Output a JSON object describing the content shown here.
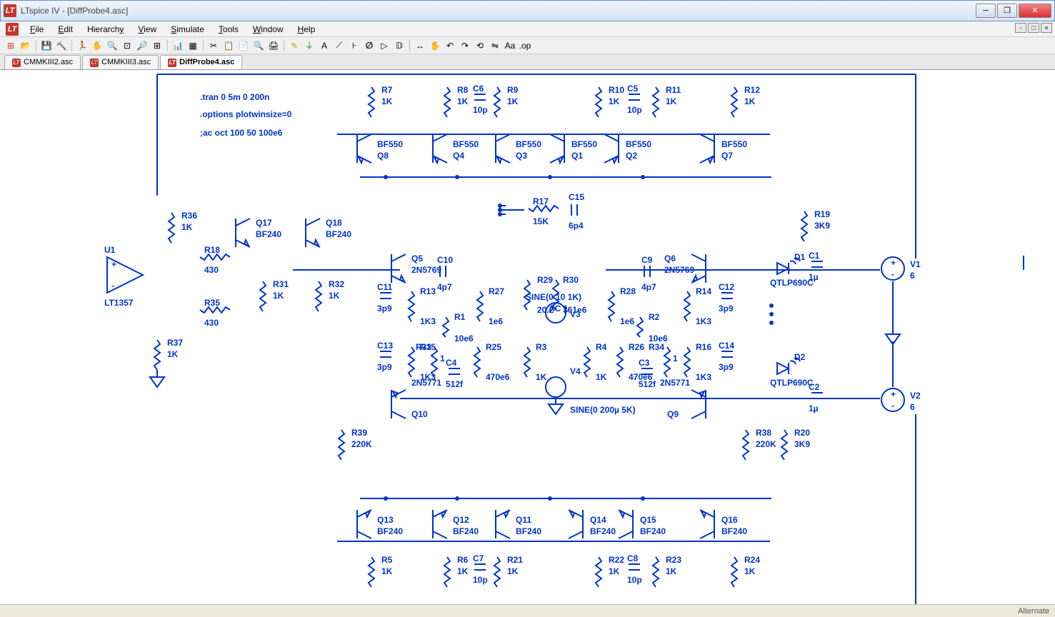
{
  "window": {
    "title": "LTspice IV - [DiffProbe4.asc]"
  },
  "menu": {
    "file": "File",
    "edit": "Edit",
    "hierarchy": "Hierarchy",
    "view": "View",
    "simulate": "Simulate",
    "tools": "Tools",
    "window": "Window",
    "help": "Help"
  },
  "tabs": [
    {
      "label": "CMMKIII2.asc",
      "active": false
    },
    {
      "label": "CMMKIII3.asc",
      "active": false
    },
    {
      "label": "DiffProbe4.asc",
      "active": true
    }
  ],
  "status": {
    "right": "Alternate"
  },
  "directives": [
    ".tran 0 5m 0 200n",
    ".options plotwinsize=0",
    ";ac oct 100 50 100e6"
  ],
  "components": {
    "transistors_top": [
      {
        "ref": "Q8",
        "model": "BF550"
      },
      {
        "ref": "Q4",
        "model": "BF550"
      },
      {
        "ref": "Q3",
        "model": "BF550"
      },
      {
        "ref": "Q1",
        "model": "BF550"
      },
      {
        "ref": "Q2",
        "model": "BF550"
      },
      {
        "ref": "Q7",
        "model": "BF550"
      }
    ],
    "transistors_mid": [
      {
        "ref": "Q17",
        "model": "BF240"
      },
      {
        "ref": "Q18",
        "model": "BF240"
      },
      {
        "ref": "Q5",
        "model": "2N5769"
      },
      {
        "ref": "Q6",
        "model": "2N5769"
      },
      {
        "ref": "Q10",
        "model": "2N5771"
      },
      {
        "ref": "Q9",
        "model": "2N5771"
      }
    ],
    "transistors_bot": [
      {
        "ref": "Q13",
        "model": "BF240"
      },
      {
        "ref": "Q12",
        "model": "BF240"
      },
      {
        "ref": "Q11",
        "model": "BF240"
      },
      {
        "ref": "Q14",
        "model": "BF240"
      },
      {
        "ref": "Q15",
        "model": "BF240"
      },
      {
        "ref": "Q16",
        "model": "BF240"
      }
    ],
    "resistors_top": [
      {
        "ref": "R7",
        "val": "1K"
      },
      {
        "ref": "R8",
        "val": "1K"
      },
      {
        "ref": "R9",
        "val": "1K"
      },
      {
        "ref": "R10",
        "val": "1K"
      },
      {
        "ref": "R11",
        "val": "1K"
      },
      {
        "ref": "R12",
        "val": "1K"
      }
    ],
    "resistors_bot": [
      {
        "ref": "R5",
        "val": "1K"
      },
      {
        "ref": "R6",
        "val": "1K"
      },
      {
        "ref": "R21",
        "val": "1K"
      },
      {
        "ref": "R22",
        "val": "1K"
      },
      {
        "ref": "R23",
        "val": "1K"
      },
      {
        "ref": "R24",
        "val": "1K"
      }
    ],
    "resistors_misc": [
      {
        "ref": "R36",
        "val": "1K"
      },
      {
        "ref": "R18",
        "val": "430"
      },
      {
        "ref": "R35",
        "val": "430"
      },
      {
        "ref": "R37",
        "val": "1K"
      },
      {
        "ref": "R31",
        "val": "1K"
      },
      {
        "ref": "R32",
        "val": "1K"
      },
      {
        "ref": "R39",
        "val": "220K"
      },
      {
        "ref": "R17",
        "val": "15K"
      },
      {
        "ref": "R19",
        "val": "3K9"
      },
      {
        "ref": "R38",
        "val": "220K"
      },
      {
        "ref": "R20",
        "val": "3K9"
      },
      {
        "ref": "R13",
        "val": "1K3"
      },
      {
        "ref": "R27",
        "val": "1e6"
      },
      {
        "ref": "R29",
        "val": "20.2"
      },
      {
        "ref": "R30",
        "val": "361e6"
      },
      {
        "ref": "R28",
        "val": "1e6"
      },
      {
        "ref": "R14",
        "val": "1K3"
      },
      {
        "ref": "R1",
        "val": "10e6"
      },
      {
        "ref": "R2",
        "val": "10e6"
      },
      {
        "ref": "R15",
        "val": "1K3"
      },
      {
        "ref": "R33",
        "val": "1"
      },
      {
        "ref": "R3",
        "val": "1K"
      },
      {
        "ref": "R4",
        "val": "1K"
      },
      {
        "ref": "R34",
        "val": "1"
      },
      {
        "ref": "R16",
        "val": "1K3"
      },
      {
        "ref": "R25",
        "val": "470e6"
      },
      {
        "ref": "R26",
        "val": "470e6"
      }
    ],
    "caps": [
      {
        "ref": "C6",
        "val": "10p"
      },
      {
        "ref": "C5",
        "val": "10p"
      },
      {
        "ref": "C7",
        "val": "10p"
      },
      {
        "ref": "C8",
        "val": "10p"
      },
      {
        "ref": "C15",
        "val": "6p4"
      },
      {
        "ref": "C1",
        "val": "1µ"
      },
      {
        "ref": "C2",
        "val": "1µ"
      },
      {
        "ref": "C10",
        "val": "4p7"
      },
      {
        "ref": "C9",
        "val": "4p7"
      },
      {
        "ref": "C11",
        "val": "3p9"
      },
      {
        "ref": "C12",
        "val": "3p9"
      },
      {
        "ref": "C13",
        "val": "3p9"
      },
      {
        "ref": "C14",
        "val": "3p9"
      },
      {
        "ref": "C4",
        "val": "512f"
      },
      {
        "ref": "C3",
        "val": "512f"
      }
    ],
    "sources": [
      {
        "ref": "V1",
        "val": "6"
      },
      {
        "ref": "V2",
        "val": "6"
      },
      {
        "ref": "V3",
        "val": "SINE(0 10 1K)",
        "extra": "AC 1"
      },
      {
        "ref": "V4",
        "val": "SINE(0 200µ 5K)"
      }
    ],
    "diodes": [
      {
        "ref": "D1",
        "model": "QTLP690C"
      },
      {
        "ref": "D2",
        "model": "QTLP690C"
      }
    ],
    "opamp": {
      "ref": "U1",
      "model": "LT1357"
    }
  }
}
